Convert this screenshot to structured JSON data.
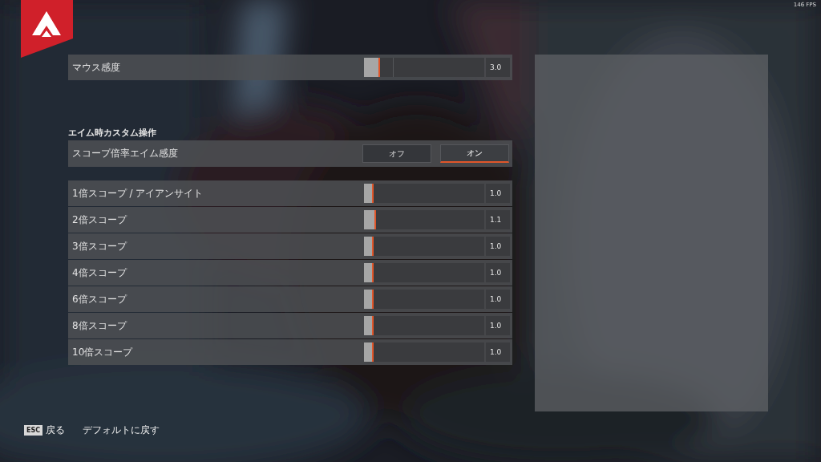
{
  "fps": "146 FPS",
  "mouse_sensitivity": {
    "label": "マウス感度",
    "level": 0.13,
    "value": "3.0"
  },
  "section_title": "エイム時カスタム操作",
  "scope_toggle": {
    "label": "スコープ倍率エイム感度",
    "options": [
      {
        "label": "オフ",
        "selected": false
      },
      {
        "label": "オン",
        "selected": true
      }
    ]
  },
  "scope_sliders": [
    {
      "label": "1倍スコープ / アイアンサイト",
      "level": 0.08,
      "value": "1.0"
    },
    {
      "label": "2倍スコープ",
      "level": 0.1,
      "value": "1.1"
    },
    {
      "label": "3倍スコープ",
      "level": 0.08,
      "value": "1.0"
    },
    {
      "label": "4倍スコープ",
      "level": 0.08,
      "value": "1.0"
    },
    {
      "label": "6倍スコープ",
      "level": 0.08,
      "value": "1.0"
    },
    {
      "label": "8倍スコープ",
      "level": 0.08,
      "value": "1.0"
    },
    {
      "label": "10倍スコープ",
      "level": 0.08,
      "value": "1.0"
    }
  ],
  "footer": {
    "key": "ESC",
    "back": "戻る",
    "reset": "デフォルトに戻す"
  }
}
